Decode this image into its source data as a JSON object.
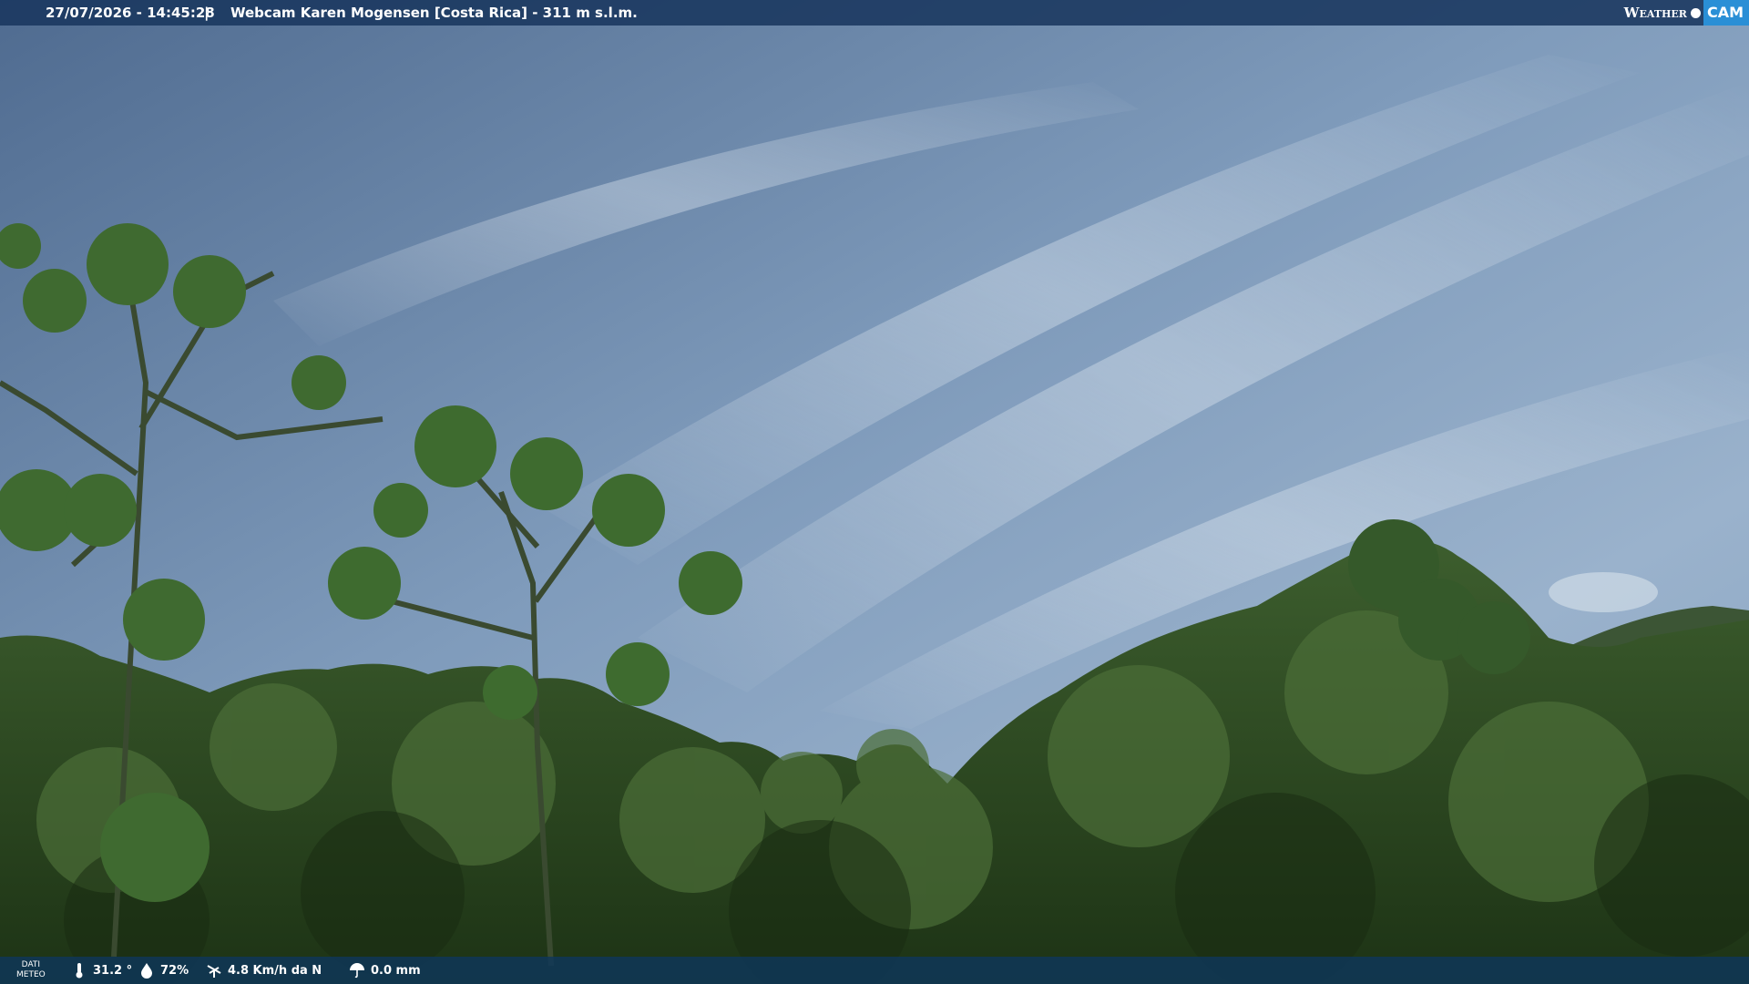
{
  "header": {
    "timestamp": "27/07/2026 - 14:45:28",
    "separator": "|",
    "title": "Webcam Karen Mogensen [Costa Rica]  - 311 m s.l.m.",
    "logo_text_1": "Weather",
    "logo_text_2": "CAM"
  },
  "weather": {
    "label_line1": "DATI",
    "label_line2": "METEO",
    "temperature": "31.2 °",
    "humidity": "72%",
    "wind": "4.8 Km/h da N",
    "rain": "0.0 mm"
  },
  "icons": [
    "thermometer-icon",
    "humidity-icon",
    "wind-icon",
    "rain-icon"
  ],
  "colors": {
    "sky": "#6f8db0",
    "forest": "#2e4a22",
    "bar": "#1a3a5c",
    "logo_accent": "#2a8fd6"
  }
}
